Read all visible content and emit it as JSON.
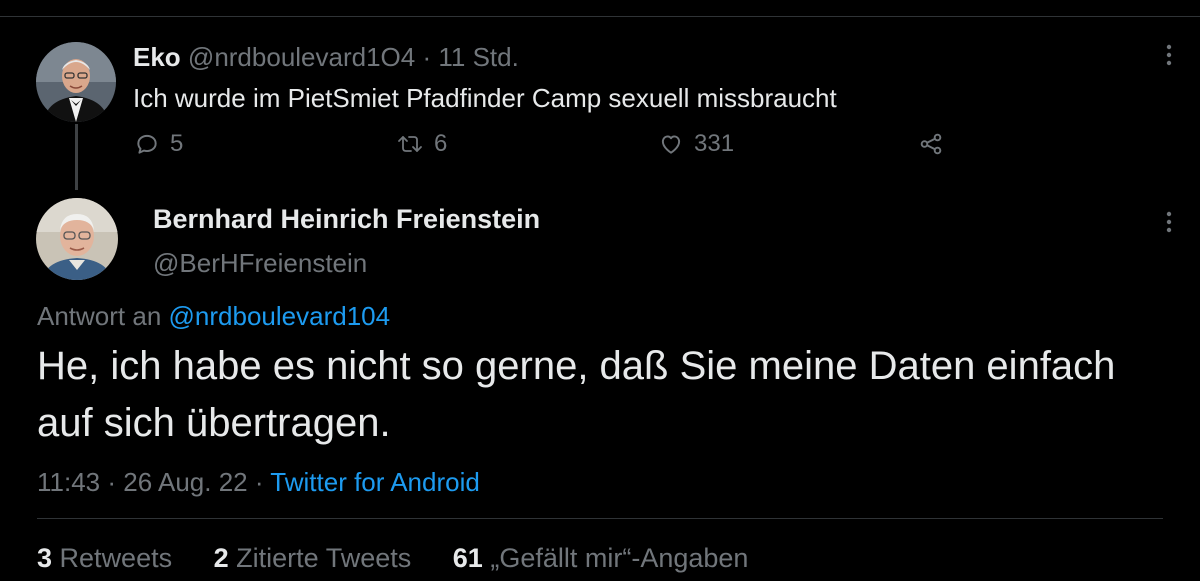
{
  "parent_tweet": {
    "display_name": "Eko",
    "handle": "@nrdboulevard1O4",
    "separator": "·",
    "time": "11 Std.",
    "text": "Ich wurde im PietSmiet Pfadfinder Camp sexuell missbraucht",
    "replies": "5",
    "retweets": "6",
    "likes": "331"
  },
  "focused_tweet": {
    "display_name": "Bernhard Heinrich Freienstein",
    "handle": "@BerHFreienstein",
    "reply_prefix": "Antwort an",
    "reply_handle": "@nrdboulevard104",
    "text": "He, ich habe es nicht so gerne, daß Sie meine Daten einfach auf sich übertragen.",
    "time": "11:43",
    "separator": "·",
    "date": "26 Aug. 22",
    "separator2": "·",
    "source": "Twitter for Android",
    "stats": {
      "retweets_count": "3",
      "retweets_label": "Retweets",
      "quotes_count": "2",
      "quotes_label": "Zitierte Tweets",
      "likes_count": "61",
      "likes_label": "„Gefällt mir“-Angaben"
    }
  },
  "icons": {
    "reply": "reply-icon",
    "retweet": "retweet-icon",
    "like": "heart-icon",
    "share": "share-icon",
    "more": "more-icon"
  },
  "colors": {
    "background": "#000000",
    "text": "#e7e9ea",
    "muted": "#71767b",
    "link": "#1d9bf0",
    "divider": "#2f3336"
  }
}
